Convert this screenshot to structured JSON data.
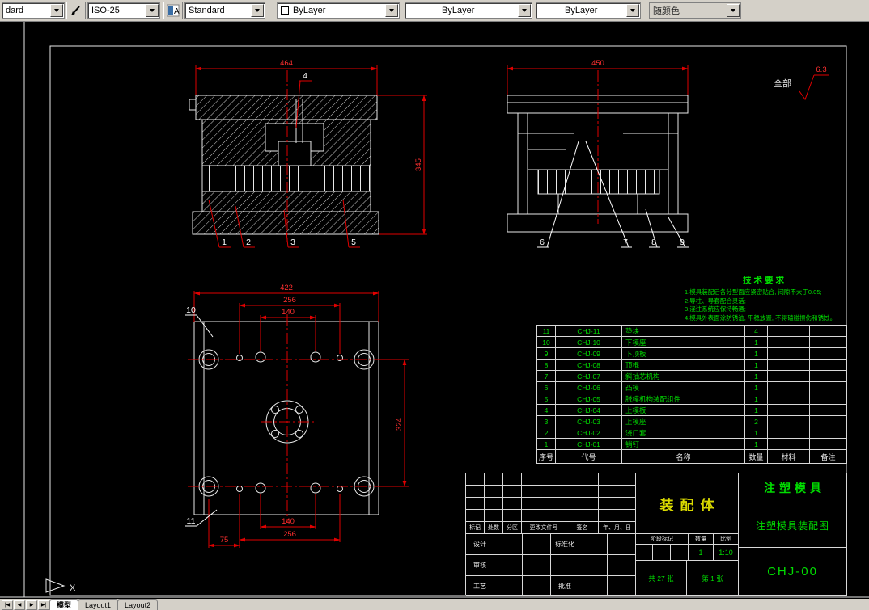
{
  "toolbar": {
    "style_partial": "dard",
    "dim_style": "ISO-25",
    "text_style": "Standard",
    "color": "ByLayer",
    "linetype": "ByLayer",
    "lineweight": "ByLayer",
    "plot_style": "随颜色"
  },
  "drawing": {
    "surface_label": "全部",
    "surface_value": "6.3",
    "notes": {
      "title": "技术要求",
      "lines": [
        "1.模具装配后各分型面应紧密贴合, 间隙不大于0.05;",
        "2.导柱、导套配合灵活;",
        "3.浇注系统应保持畅通;",
        "4.模具外表面涂防锈油, 平稳放置, 不得磕碰擦伤和锈蚀。"
      ]
    },
    "dims": {
      "section": {
        "width": "464",
        "height": "345"
      },
      "side": {
        "width": "450"
      },
      "plan_top": [
        "422",
        "256",
        "140"
      ],
      "plan_right": "324",
      "plan_bottom": [
        "140",
        "256",
        "75"
      ]
    },
    "balloons": {
      "b1": "1",
      "b2": "2",
      "b3": "3",
      "b4": "4",
      "b5": "5",
      "b6": "6",
      "b7": "7",
      "b8": "8",
      "b9": "9",
      "b10": "10",
      "b11": "11"
    }
  },
  "bom": {
    "headers": [
      "序号",
      "代号",
      "名称",
      "数量",
      "材料",
      "备注"
    ],
    "rows": [
      [
        "11",
        "CHJ-11",
        "垫块",
        "4",
        "",
        ""
      ],
      [
        "10",
        "CHJ-10",
        "下模座",
        "1",
        "",
        ""
      ],
      [
        "9",
        "CHJ-09",
        "下顶板",
        "1",
        "",
        ""
      ],
      [
        "8",
        "CHJ-08",
        "顶棍",
        "1",
        "",
        ""
      ],
      [
        "7",
        "CHJ-07",
        "斜抽芯机构",
        "1",
        "",
        ""
      ],
      [
        "6",
        "CHJ-06",
        "凸模",
        "1",
        "",
        ""
      ],
      [
        "5",
        "CHJ-05",
        "脱模机构装配组件",
        "1",
        "",
        ""
      ],
      [
        "4",
        "CHJ-04",
        "上模板",
        "1",
        "",
        ""
      ],
      [
        "3",
        "CHJ-03",
        "上模座",
        "2",
        "",
        ""
      ],
      [
        "2",
        "CHJ-02",
        "浇口套",
        "1",
        "",
        ""
      ],
      [
        "1",
        "CHJ-01",
        "销钉",
        "1",
        "",
        ""
      ]
    ]
  },
  "title_block": {
    "part_name": "装配体",
    "project": "注塑模具",
    "drawing_title": "注塑模具装配图",
    "drawing_no": "CHJ-00",
    "stage_label": "阶段标记",
    "qty_label": "数量",
    "scale_label": "比例",
    "qty_value": "1",
    "scale_value": "1:10",
    "sheet_total": "共 27 张",
    "sheet_no": "第 1 张",
    "rev_headers": [
      "标记",
      "处数",
      "分区",
      "更改文件号",
      "签名",
      "年、月、日"
    ],
    "sig_left": [
      "设计",
      "审核",
      "工艺"
    ],
    "sig_mid": [
      "标准化",
      "",
      "批准"
    ]
  },
  "tabs": {
    "nav": [
      "|◀",
      "◀",
      "▶",
      "▶|"
    ],
    "model": "模型",
    "layout1": "Layout1",
    "layout2": "Layout2"
  },
  "ucs_label": "X"
}
